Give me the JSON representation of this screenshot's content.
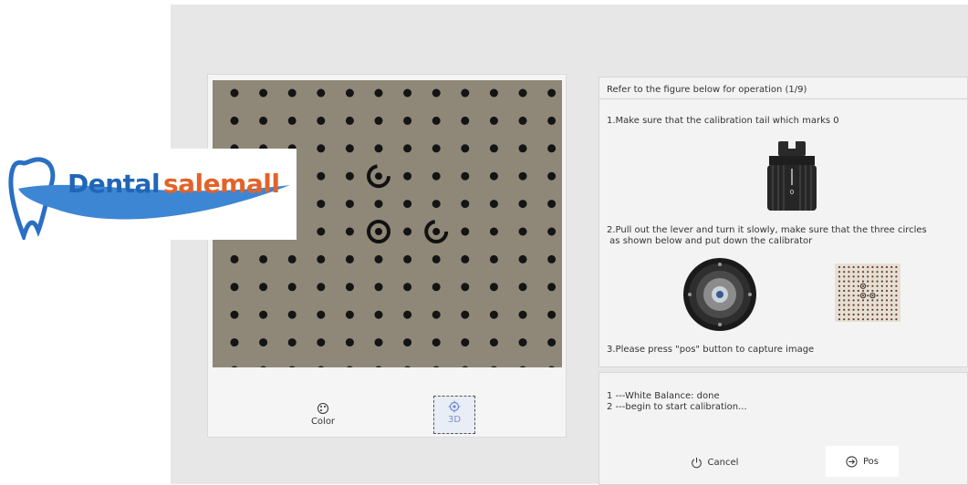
{
  "logo": {
    "part1": "Dental",
    "part2": "salemall"
  },
  "camera": {
    "modes": [
      {
        "label": "Color",
        "icon": "palette-icon"
      },
      {
        "label": "3D",
        "icon": "target-icon",
        "selected": true
      }
    ]
  },
  "instructions": {
    "title": "Refer to the figure below for operation (1/9)",
    "step1": "1.Make sure that the calibration tail which marks 0",
    "step2_line1": "2.Pull out the lever and turn it slowly, make sure that the three circles",
    "step2_line2": " as shown below and put down the calibrator",
    "step3": "3.Please press \"pos\" button to capture image",
    "calibrator_mark": "0"
  },
  "log": {
    "lines": [
      "1 ---White Balance: done",
      "2 ---begin to start calibration..."
    ]
  },
  "buttons": {
    "cancel": "Cancel",
    "pos": "Pos"
  },
  "colors": {
    "logo_blue": "#2066b8",
    "logo_orange": "#e2632a",
    "selected_mode": "#7a8fc7",
    "camera_background": "#8d8676"
  }
}
